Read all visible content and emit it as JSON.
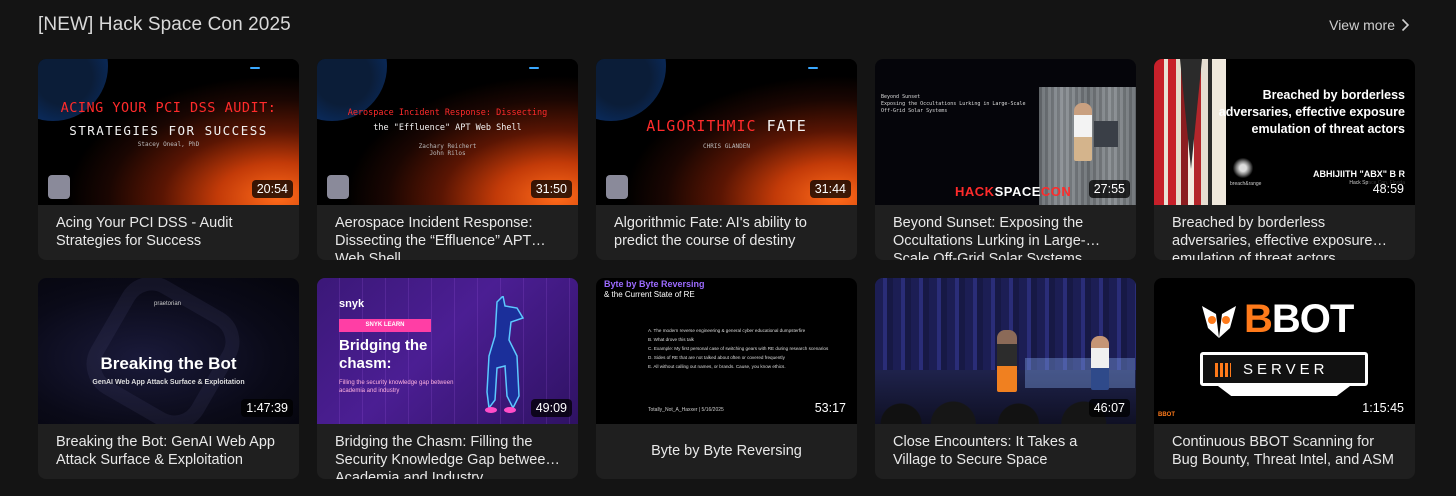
{
  "section": {
    "title": "[NEW] Hack Space Con 2025",
    "view_more": "View more"
  },
  "videos": [
    {
      "title": "Acing Your PCI DSS - Audit Strategies for Success",
      "duration": "20:54",
      "thumb": {
        "line1": "ACING YOUR PCI DSS AUDIT:",
        "line2": "STRATEGIES FOR SUCCESS",
        "speaker": "Stacey Oneal, PhD"
      }
    },
    {
      "title": "Aerospace Incident Response: Dissecting the “Effluence” APT Web Shell",
      "duration": "31:50",
      "thumb": {
        "line1": "Aerospace Incident Response: Dissecting",
        "line2": "the \"Effluence\" APT Web Shell",
        "speaker": "Zachary Reichert\nJohn Rilos"
      }
    },
    {
      "title": "Algorithmic Fate: AI's ability to predict the course of destiny",
      "duration": "31:44",
      "thumb": {
        "line1": "ALGORITHMIC",
        "line2": "FATE",
        "speaker": "CHRIS GLANDEN"
      }
    },
    {
      "title": "Beyond Sunset: Exposing the Occultations Lurking in Large-Scale Off-Grid Solar Systems",
      "duration": "27:55",
      "thumb": {
        "brand_a": "HACK",
        "brand_b": "SPACE",
        "brand_c": "CON"
      }
    },
    {
      "title": "Breached by borderless adversaries, effective exposure emulation of threat actors",
      "duration": "48:59",
      "thumb": {
        "headline": "Breached by borderless adversaries, effective exposure emulation of threat actors",
        "name": "ABHIJIITH \"ABX\" B R",
        "event": "Hack Space Con, Florida",
        "tag": "breach&range"
      }
    },
    {
      "title": "Breaking the Bot: GenAI Web App Attack Surface & Exploitation",
      "duration": "1:47:39",
      "thumb": {
        "logo": "praetorian",
        "headline": "Breaking the Bot",
        "sub": "GenAI Web App Attack Surface & Exploitation"
      }
    },
    {
      "title": "Bridging the Chasm: Filling the Security Knowledge Gap between Academia and Industry",
      "duration": "49:09",
      "thumb": {
        "logo": "snyk",
        "badge": "SNYK LEARN",
        "headline_1": "Bridging the",
        "headline_2": "chasm:",
        "desc": "Filling the security knowledge gap between academia and industry"
      }
    },
    {
      "title": "Byte by Byte Reversing",
      "duration": "53:17",
      "thumb": {
        "h1": "Byte by Byte Reversing",
        "h2": "& the Current State of RE",
        "footer": "Totally_Not_A_Haxxer | 5/16/2025"
      }
    },
    {
      "title": "Close Encounters: It Takes a Village to Secure Space",
      "duration": "46:07",
      "thumb": {}
    },
    {
      "title": "Continuous BBOT Scanning for Bug Bounty, Threat Intel, and ASM",
      "duration": "1:15:45",
      "thumb": {
        "word_b": "B",
        "word_rest": "BOT",
        "server": "SERVER",
        "corner": "BBOT"
      }
    }
  ],
  "colors": {
    "background": "#141414",
    "card": "#1f1f1f",
    "accent_red": "#ff2b2b",
    "accent_orange": "#ff7a1a"
  }
}
